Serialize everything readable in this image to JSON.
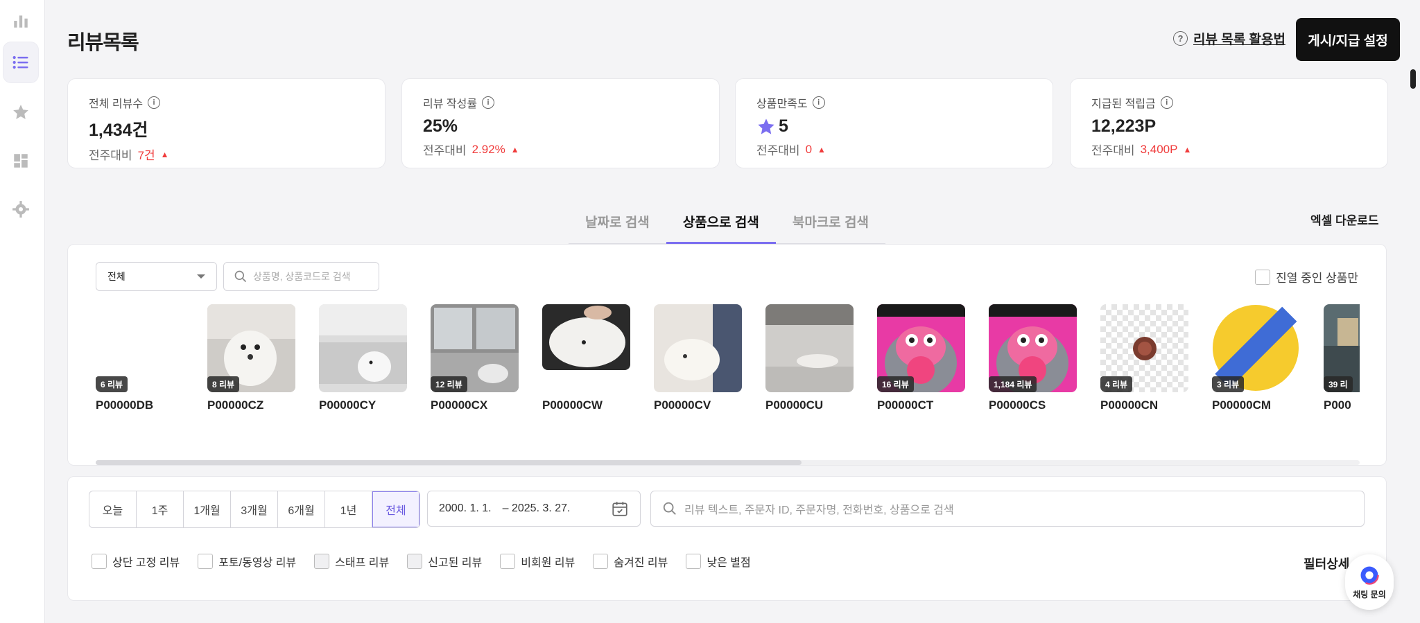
{
  "header": {
    "title": "리뷰목록",
    "help_link": "리뷰 목록 활용법",
    "setting_button": "게시/지급 설정"
  },
  "stats": [
    {
      "label": "전체 리뷰수",
      "value": "1,434건",
      "compare_label": "전주대비",
      "delta": "7건"
    },
    {
      "label": "리뷰 작성률",
      "value": "25%",
      "compare_label": "전주대비",
      "delta": "2.92%"
    },
    {
      "label": "상품만족도",
      "value": "5",
      "compare_label": "전주대비",
      "delta": "0"
    },
    {
      "label": "지급된 적립금",
      "value": "12,223P",
      "compare_label": "전주대비",
      "delta": "3,400P"
    }
  ],
  "tabs": [
    "날짜로 검색",
    "상품으로 검색",
    "북마크로 검색"
  ],
  "active_tab": "상품으로 검색",
  "excel_download": "엑셀 다운로드",
  "product_filter": {
    "category_value": "전체",
    "search_placeholder": "상품명, 상품코드로 검색",
    "only_displayed_label": "진열 중인 상품만"
  },
  "products": [
    {
      "code": "P00000DB",
      "badge": "6 리뷰",
      "image": "none"
    },
    {
      "code": "P00000CZ",
      "badge": "8 리뷰",
      "image": "white-dog"
    },
    {
      "code": "P00000CY",
      "badge": "",
      "image": "dog-on-sofa"
    },
    {
      "code": "P00000CX",
      "badge": "12 리뷰",
      "image": "dog-window"
    },
    {
      "code": "P00000CW",
      "badge": "",
      "image": "fluffy-dog"
    },
    {
      "code": "P00000CV",
      "badge": "",
      "image": "sleeping-dog"
    },
    {
      "code": "P00000CU",
      "badge": "",
      "image": "dog-lying-sofa"
    },
    {
      "code": "P00000CT",
      "badge": "16 리뷰",
      "image": "pink-character"
    },
    {
      "code": "P00000CS",
      "badge": "1,184 리뷰",
      "image": "pink-character"
    },
    {
      "code": "P00000CN",
      "badge": "4 리뷰",
      "image": "small-food"
    },
    {
      "code": "P00000CM",
      "badge": "3 리뷰",
      "image": "example-badge"
    },
    {
      "code": "P000",
      "badge": "39 리",
      "image": "room"
    }
  ],
  "period_buttons": [
    "오늘",
    "1주",
    "1개월",
    "3개월",
    "6개월",
    "1년",
    "전체"
  ],
  "active_period": "전체",
  "date_range": {
    "start": "2000. 1. 1.",
    "end": "– 2025. 3. 27."
  },
  "review_search_placeholder": "리뷰 텍스트, 주문자 ID, 주문자명, 전화번호, 상품으로 검색",
  "review_filters": [
    "상단 고정 리뷰",
    "포토/동영상 리뷰",
    "스태프 리뷰",
    "신고된 리뷰",
    "비회원 리뷰",
    "숨겨진 리뷰",
    "낮은 별점"
  ],
  "filter_detail": "필터상세",
  "chat_label": "채팅 문의",
  "colors": {
    "accent": "#7b6ef0",
    "delta": "#f03c3c",
    "primary_button": "#111111"
  }
}
